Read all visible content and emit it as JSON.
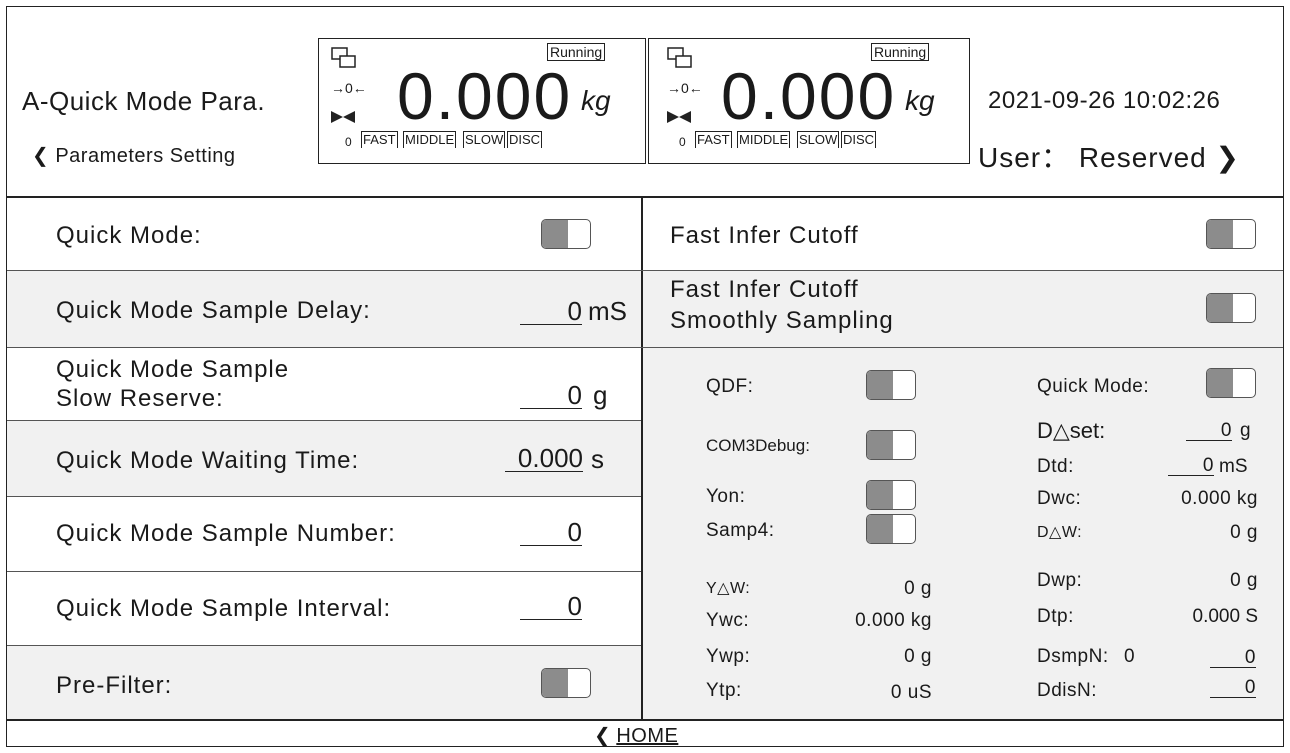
{
  "header": {
    "title": "A-Quick Mode Para.",
    "back_label": "Parameters Setting",
    "datetime": "2021-09-26 10:02:26",
    "user_label": "User： Reserved"
  },
  "displays": [
    {
      "weight": "0.000",
      "unit": "kg",
      "status": "Running",
      "zero_mark": "→0←",
      "tick": "0",
      "segments": [
        "FAST",
        "MIDDLE",
        "SLOW",
        "DISC"
      ]
    },
    {
      "weight": "0.000",
      "unit": "kg",
      "status": "Running",
      "zero_mark": "→0←",
      "tick": "0",
      "segments": [
        "FAST",
        "MIDDLE",
        "SLOW",
        "DISC"
      ]
    }
  ],
  "left": {
    "quick_mode": "Quick Mode:",
    "sample_delay": {
      "label": "Quick Mode Sample Delay:",
      "value": "0",
      "unit": "mS"
    },
    "slow_reserve": {
      "label1": "Quick Mode Sample",
      "label2": "Slow Reserve:",
      "value": "0",
      "unit": "g"
    },
    "waiting_time": {
      "label": "Quick Mode Waiting Time:",
      "value": "0.000",
      "unit": "s"
    },
    "sample_number": {
      "label": "Quick Mode Sample Number:",
      "value": "0"
    },
    "sample_interval": {
      "label": "Quick Mode Sample Interval:",
      "value": "0"
    },
    "pre_filter": "Pre-Filter:"
  },
  "right": {
    "fast_infer_cutoff": "Fast Infer Cutoff",
    "smooth_line1": "Fast Infer Cutoff",
    "smooth_line2": "Smoothly Sampling"
  },
  "diag": {
    "qdf": "QDF:",
    "quick_mode": "Quick Mode:",
    "com3debug": "COM3Debug:",
    "yon": "Yon:",
    "samp4": "Samp4:",
    "dset": {
      "label": "D△set:",
      "value": "0",
      "unit": "g"
    },
    "dtd": {
      "label": "Dtd:",
      "value": "0",
      "unit": "mS"
    },
    "dwc": {
      "label": "Dwc:",
      "value": "0.000 kg"
    },
    "ddw": {
      "label": "D△W:",
      "value": "0 g"
    },
    "ydw": {
      "label": "Y△W:",
      "value": "0 g"
    },
    "dwp": {
      "label": "Dwp:",
      "value": "0 g"
    },
    "ywc": {
      "label": "Ywc:",
      "value": "0.000 kg"
    },
    "dtp": {
      "label": "Dtp:",
      "value": "0.000 S"
    },
    "ywp": {
      "label": "Ywp:",
      "value": "0 g"
    },
    "dsmpn": {
      "label": "DsmpN:",
      "count": "0",
      "value": "0"
    },
    "ytp": {
      "label": "Ytp:",
      "value": "0 uS"
    },
    "ddisn": {
      "label": "DdisN:",
      "value": "0"
    }
  },
  "footer": {
    "home_label": "HOME"
  }
}
